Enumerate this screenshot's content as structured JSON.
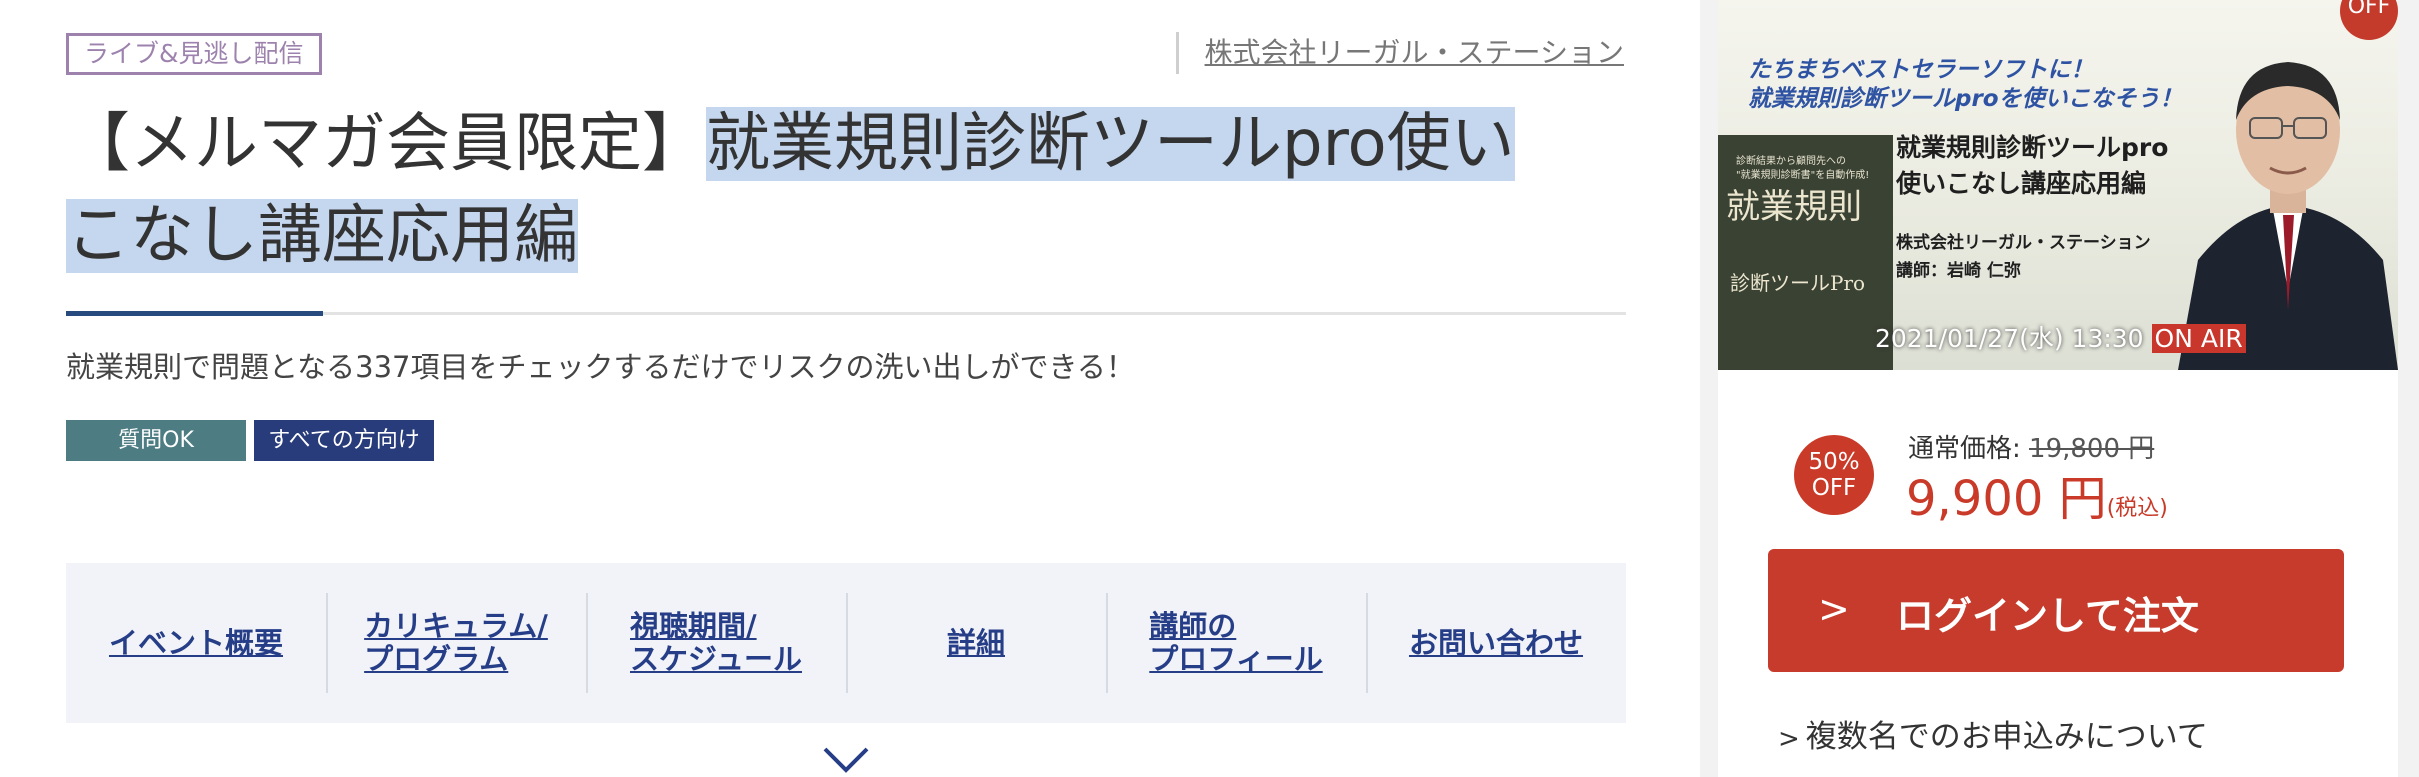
{
  "event": {
    "badge": "ライブ&見逃し配信",
    "company": "株式会社リーガル・ステーション",
    "title_prefix": "【メルマガ会員限定】",
    "title_highlight_1": "就業規則診断ツールpro使い",
    "title_highlight_2": "こなし講座応用編",
    "subtitle": "就業規則で問題となる337項目をチェックするだけでリスクの洗い出しができる！",
    "tags": [
      "質問OK",
      "すべての方向け"
    ]
  },
  "nav": {
    "items": [
      "イベント概要",
      "カリキュラム/\nプログラム",
      "視聴期間/\nスケジュール",
      "詳細",
      "講師の\nプロフィール",
      "お問い合わせ"
    ]
  },
  "promo": {
    "headline_1": "たちまちベストセラーソフトに！",
    "headline_2": "就業規則診断ツールproを使いこなそう！",
    "book_sub_1": "診断結果から顧問先への",
    "book_sub_2": "\"就業規則診断書\"を自動作成!",
    "book_title_1": "就業規則",
    "book_title_2": "診断ツールPro",
    "title_1": "就業規則診断ツールpro",
    "title_2": "使いこなし講座応用編",
    "company": "株式会社リーガル・ステーション",
    "lecturer": "講師：岩崎 仁弥",
    "date": "2021/01/27(水) 13:30",
    "onair": "ON AIR",
    "corner_badge": "OFF"
  },
  "pricing": {
    "discount_1": "50%",
    "discount_2": "OFF",
    "regular_label": "通常価格:",
    "regular_price": "19,800 円",
    "price": "9,900 円",
    "tax": "(税込)"
  },
  "actions": {
    "login_arrow": ">",
    "login_label": "ログインして注文",
    "multi_arrow": ">",
    "multi_label": "複数名でのお申込みについて"
  },
  "colors": {
    "accent_red": "#c63b2b",
    "nav_link": "#263e87",
    "badge_purple": "#9c82ad",
    "highlight": "#c5d7ef"
  }
}
